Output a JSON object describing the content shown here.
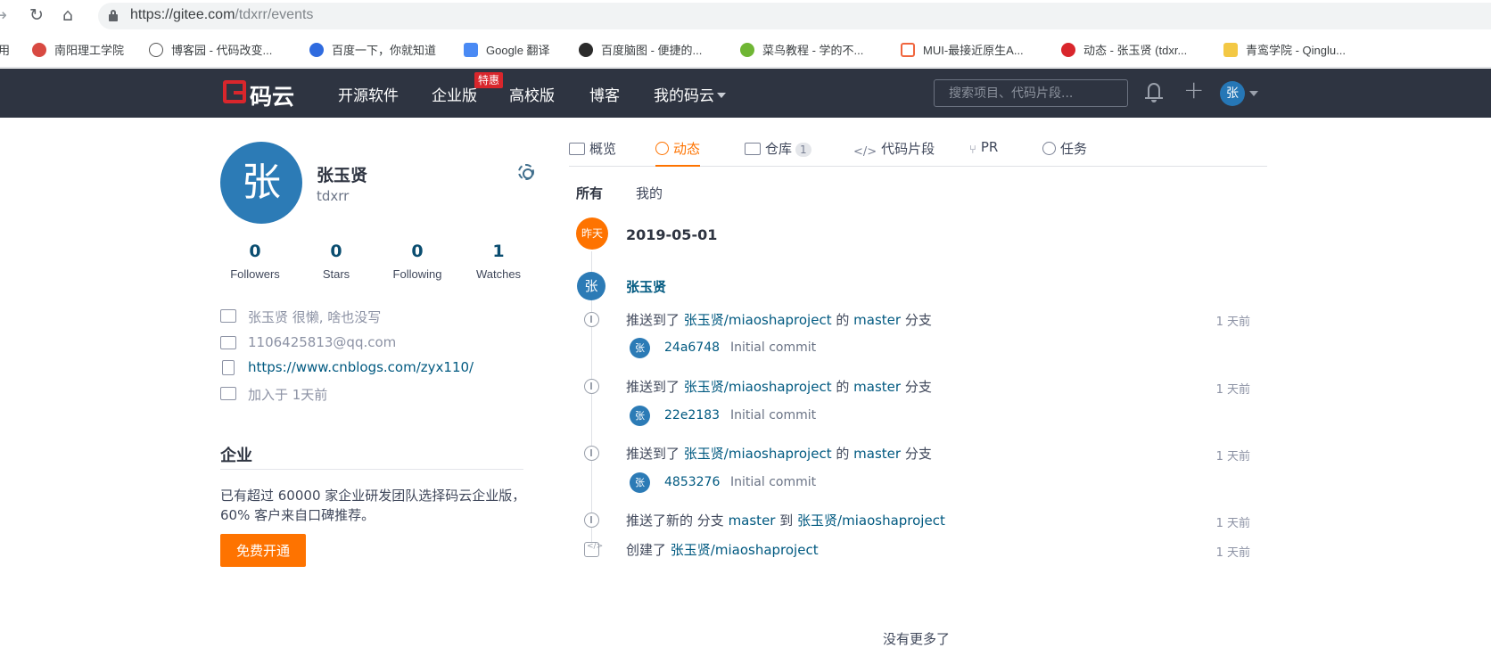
{
  "browser": {
    "url_main": "https://gitee.com",
    "url_rest": "/tdxrr/events",
    "bookmarks": [
      {
        "label": "用",
        "color": "#ffffff"
      },
      {
        "label": "南阳理工学院",
        "color": "#d84a42"
      },
      {
        "label": "博客园 - 代码改变...",
        "color": "#ffffff"
      },
      {
        "label": "百度一下，你就知道",
        "color": "#2f6bdf"
      },
      {
        "label": "Google 翻译",
        "color": "#4a8af4"
      },
      {
        "label": "百度脑图 - 便捷的...",
        "color": "#2b2b2b"
      },
      {
        "label": "菜鸟教程 - 学的不...",
        "color": "#6fb634"
      },
      {
        "label": "MUI-最接近原生A...",
        "color": "#f0653d"
      },
      {
        "label": "动态 - 张玉贤 (tdxr...",
        "color": "#d9262c"
      },
      {
        "label": "青鸾学院 - Qinglu...",
        "color": "#f3c844"
      }
    ]
  },
  "header": {
    "logo_text": "码云",
    "nav": [
      "开源软件",
      "企业版",
      "高校版",
      "博客",
      "我的码云"
    ],
    "badge": "特惠",
    "search_placeholder": "搜索项目、代码片段...",
    "avatar_char": "张"
  },
  "profile": {
    "avatar_char": "张",
    "name": "张玉贤",
    "username": "tdxrr",
    "stats": [
      {
        "value": "0",
        "label": "Followers"
      },
      {
        "value": "0",
        "label": "Stars"
      },
      {
        "value": "0",
        "label": "Following"
      },
      {
        "value": "1",
        "label": "Watches"
      }
    ],
    "bio": "张玉贤 很懒, 啥也没写",
    "email": "1106425813@qq.com",
    "website": "https://www.cnblogs.com/zyx110/",
    "joined": "加入于 1天前"
  },
  "enterprise": {
    "title": "企业",
    "desc": "已有超过 60000 家企业研发团队选择码云企业版，60% 客户来自口碑推荐。",
    "button": "免费开通"
  },
  "tabs": [
    {
      "label": "概览"
    },
    {
      "label": "动态"
    },
    {
      "label": "仓库",
      "count": "1"
    },
    {
      "label": "代码片段"
    },
    {
      "label": "PR"
    },
    {
      "label": "任务"
    }
  ],
  "subtabs": [
    "所有",
    "我的"
  ],
  "timeline": {
    "day_label": "昨天",
    "date": "2019-05-01",
    "user_char": "张",
    "user": "张玉贤",
    "push_events": [
      {
        "prefix": "推送到了",
        "repo": "张玉贤/miaoshaproject",
        "mid": "的",
        "branch": "master",
        "suffix": "分支",
        "time": "1 天前",
        "commit_hash": "24a6748",
        "commit_msg": "Initial commit"
      },
      {
        "prefix": "推送到了",
        "repo": "张玉贤/miaoshaproject",
        "mid": "的",
        "branch": "master",
        "suffix": "分支",
        "time": "1 天前",
        "commit_hash": "22e2183",
        "commit_msg": "Initial commit"
      },
      {
        "prefix": "推送到了",
        "repo": "张玉贤/miaoshaproject",
        "mid": "的",
        "branch": "master",
        "suffix": "分支",
        "time": "1 天前",
        "commit_hash": "4853276",
        "commit_msg": "Initial commit"
      }
    ],
    "branch_event": {
      "prefix": "推送了新的 分支",
      "branch": "master",
      "mid": "到",
      "repo": "张玉贤/miaoshaproject",
      "time": "1 天前"
    },
    "create_event": {
      "prefix": "创建了",
      "repo": "张玉贤/miaoshaproject",
      "time": "1 天前"
    },
    "no_more": "没有更多了"
  }
}
